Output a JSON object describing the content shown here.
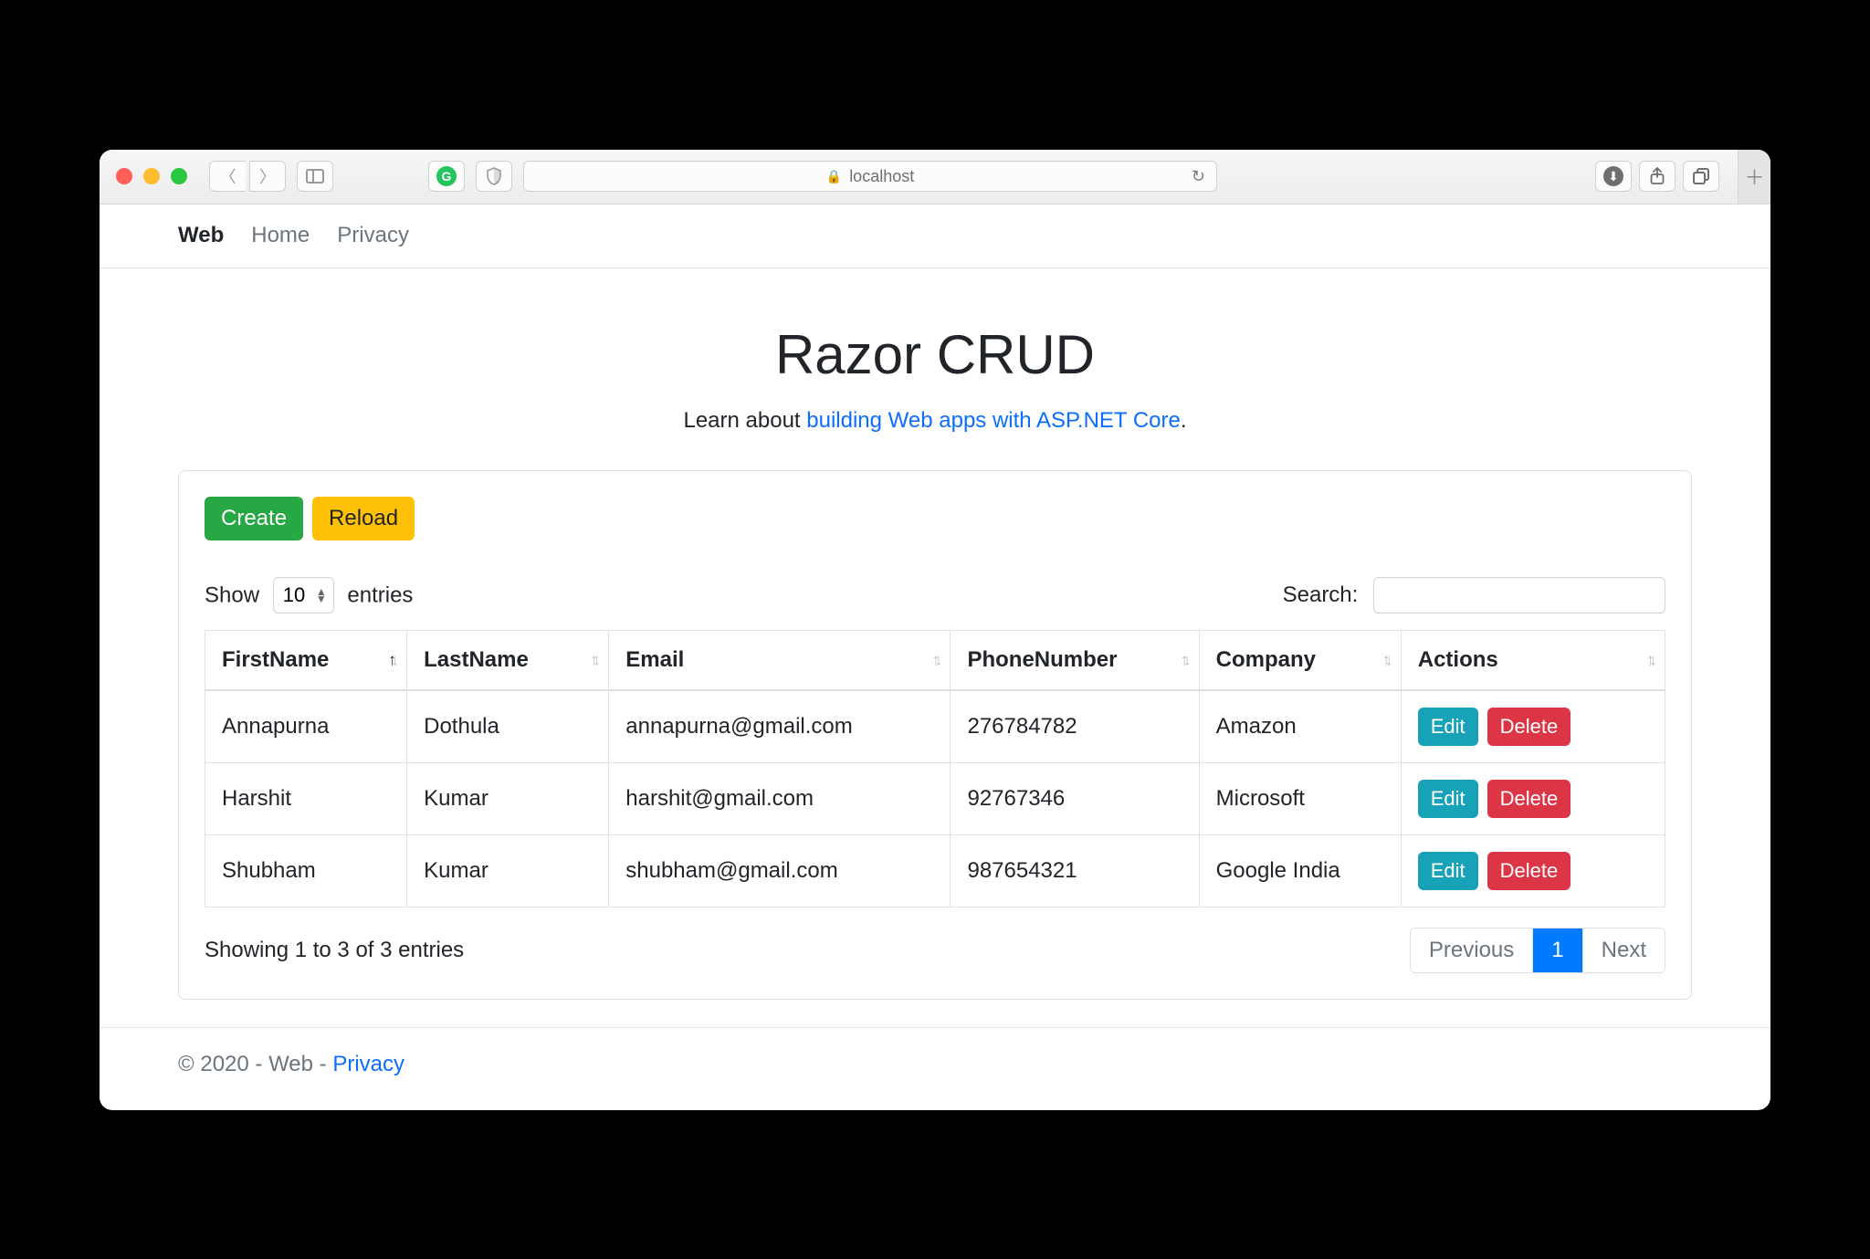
{
  "browser": {
    "address": "localhost"
  },
  "nav": {
    "brand": "Web",
    "links": [
      "Home",
      "Privacy"
    ]
  },
  "page": {
    "title": "Razor CRUD",
    "lead_prefix": "Learn about ",
    "lead_link": "building Web apps with ASP.NET Core",
    "lead_suffix": "."
  },
  "toolbar": {
    "create": "Create",
    "reload": "Reload"
  },
  "datatable": {
    "length": {
      "prefix": "Show",
      "suffix": "entries",
      "value": "10"
    },
    "search_label": "Search:",
    "columns": [
      "FirstName",
      "LastName",
      "Email",
      "PhoneNumber",
      "Company",
      "Actions"
    ],
    "rows": [
      {
        "first": "Annapurna",
        "last": "Dothula",
        "email": "annapurna@gmail.com",
        "phone": "276784782",
        "company": "Amazon"
      },
      {
        "first": "Harshit",
        "last": "Kumar",
        "email": "harshit@gmail.com",
        "phone": "92767346",
        "company": "Microsoft"
      },
      {
        "first": "Shubham",
        "last": "Kumar",
        "email": "shubham@gmail.com",
        "phone": "987654321",
        "company": "Google India"
      }
    ],
    "action_labels": {
      "edit": "Edit",
      "delete": "Delete"
    },
    "info": "Showing 1 to 3 of 3 entries",
    "pager": {
      "previous": "Previous",
      "next": "Next",
      "pages": [
        "1"
      ],
      "active": 0
    }
  },
  "footer": {
    "text": "© 2020 - Web - ",
    "link": "Privacy"
  }
}
